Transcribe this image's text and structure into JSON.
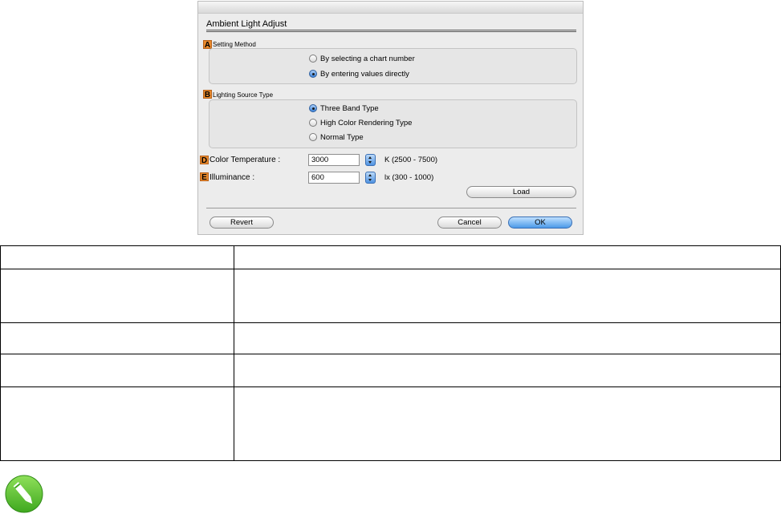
{
  "dialog": {
    "title": "Ambient Light Adjust",
    "sections": {
      "setting_method": {
        "badge": "A",
        "label": "Setting Method",
        "options": [
          {
            "label": "By selecting a chart number",
            "selected": false
          },
          {
            "label": "By entering values directly",
            "selected": true
          }
        ]
      },
      "lighting_source": {
        "badge": "B",
        "label": "Lighting Source Type",
        "options": [
          {
            "label": "Three Band Type",
            "selected": true
          },
          {
            "label": "High Color Rendering Type",
            "selected": false
          },
          {
            "label": "Normal Type",
            "selected": false
          }
        ]
      }
    },
    "color_temperature": {
      "badge": "D",
      "label": "Color Temperature :",
      "value": "3000",
      "range": "K (2500 - 7500)"
    },
    "illuminance": {
      "badge": "E",
      "label": "Illuminance :",
      "value": "600",
      "range": "lx (300 - 1000)"
    },
    "buttons": {
      "load": "Load",
      "revert": "Revert",
      "cancel": "Cancel",
      "ok": "OK"
    },
    "colors": {
      "badge": "#e8892c",
      "accent": "#4c9ae8"
    }
  },
  "table": {
    "rows": 5
  },
  "note_icon": "pencil-note-icon"
}
